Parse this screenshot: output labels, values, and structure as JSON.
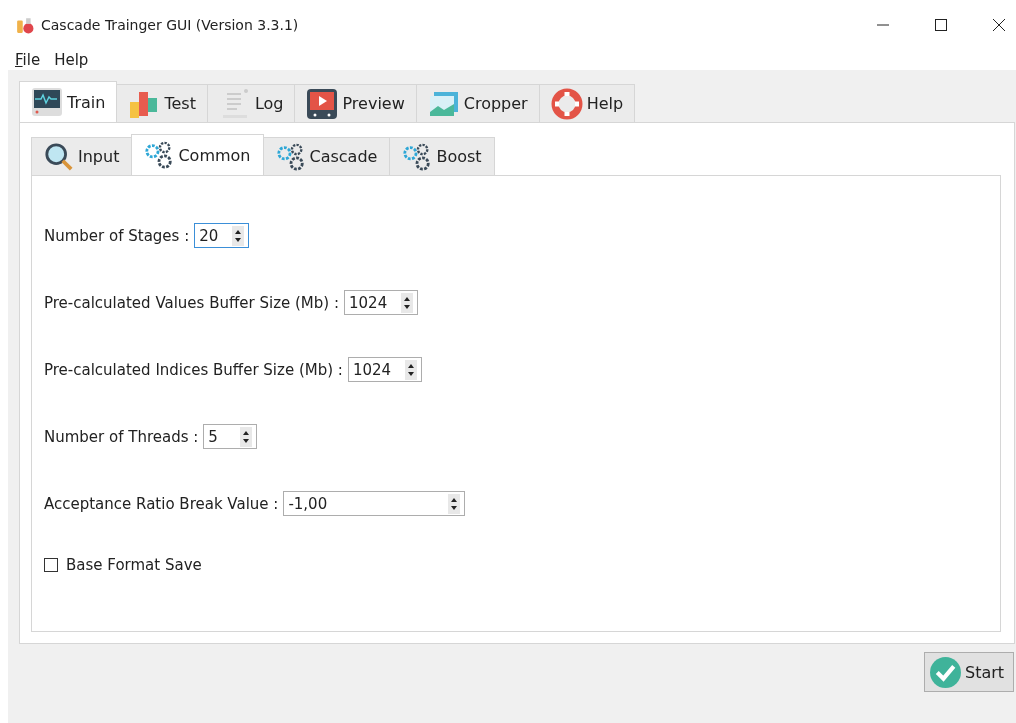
{
  "window": {
    "title": "Cascade Trainger GUI (Version 3.3.1)"
  },
  "menu": [
    {
      "label": "File",
      "mnemonic": true
    },
    {
      "label": "Help",
      "mnemonic": false
    }
  ],
  "tabs": [
    {
      "label": "Train",
      "kind": "monitor",
      "selected": true
    },
    {
      "label": "Test",
      "kind": "bars",
      "selected": false
    },
    {
      "label": "Log",
      "kind": "document",
      "selected": false
    },
    {
      "label": "Preview",
      "kind": "play",
      "selected": false
    },
    {
      "label": "Cropper",
      "kind": "image",
      "selected": false
    },
    {
      "label": "Help",
      "kind": "lifebuoy",
      "selected": false
    }
  ],
  "subtabs": [
    {
      "label": "Input",
      "kind": "magnifier",
      "selected": false
    },
    {
      "label": "Common",
      "kind": "gears",
      "selected": true
    },
    {
      "label": "Cascade",
      "kind": "gears",
      "selected": false
    },
    {
      "label": "Boost",
      "kind": "gears",
      "selected": false
    }
  ],
  "fields": [
    {
      "label": "Number of Stages :",
      "value": "20",
      "focused": true,
      "wide": false
    },
    {
      "label": "Pre-calculated Values Buffer Size (Mb) :",
      "value": "1024",
      "focused": false,
      "wide": false
    },
    {
      "label": "Pre-calculated Indices Buffer Size (Mb) :",
      "value": "1024",
      "focused": false,
      "wide": false
    },
    {
      "label": "Number of Threads :",
      "value": "5",
      "focused": false,
      "wide": false
    },
    {
      "label": "Acceptance Ratio Break Value :",
      "value": "-1,00",
      "focused": false,
      "wide": true
    }
  ],
  "checkbox": {
    "label": "Base Format Save",
    "checked": false
  },
  "start_button": {
    "label": "Start"
  }
}
